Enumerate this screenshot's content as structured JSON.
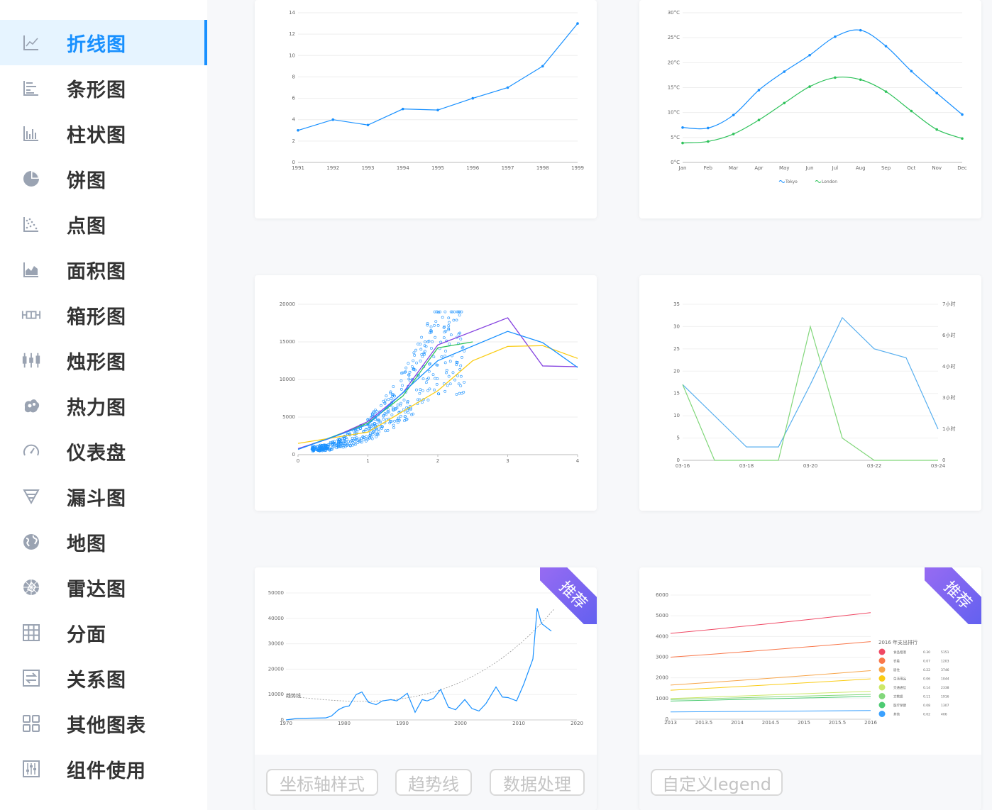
{
  "sidebar": {
    "items": [
      {
        "label": "折线图",
        "icon": "line-chart-icon"
      },
      {
        "label": "条形图",
        "icon": "bar-chart-icon"
      },
      {
        "label": "柱状图",
        "icon": "column-chart-icon"
      },
      {
        "label": "饼图",
        "icon": "pie-chart-icon"
      },
      {
        "label": "点图",
        "icon": "scatter-chart-icon"
      },
      {
        "label": "面积图",
        "icon": "area-chart-icon"
      },
      {
        "label": "箱形图",
        "icon": "box-plot-icon"
      },
      {
        "label": "烛形图",
        "icon": "candlestick-icon"
      },
      {
        "label": "热力图",
        "icon": "heatmap-icon"
      },
      {
        "label": "仪表盘",
        "icon": "gauge-icon"
      },
      {
        "label": "漏斗图",
        "icon": "funnel-icon"
      },
      {
        "label": "地图",
        "icon": "globe-icon"
      },
      {
        "label": "雷达图",
        "icon": "radar-icon"
      },
      {
        "label": "分面",
        "icon": "facet-grid-icon"
      },
      {
        "label": "关系图",
        "icon": "relation-icon"
      },
      {
        "label": "其他图表",
        "icon": "other-charts-icon"
      },
      {
        "label": "组件使用",
        "icon": "components-icon"
      }
    ],
    "active_index": 0,
    "accent_color": "#1890ff"
  },
  "cards": {
    "ribbon_label": "推荐",
    "tags_left": [
      "坐标轴样式",
      "趋势线",
      "数据处理"
    ],
    "tags_right": [
      "自定义legend"
    ]
  },
  "chart_data": [
    {
      "type": "line",
      "x": [
        "1991",
        "1992",
        "1993",
        "1994",
        "1995",
        "1996",
        "1997",
        "1998",
        "1999"
      ],
      "series": [
        {
          "values": [
            3,
            4,
            3.5,
            5,
            4.9,
            6,
            7,
            9,
            13
          ]
        }
      ],
      "yticks": [
        "0",
        "2",
        "4",
        "6",
        "8",
        "10",
        "12",
        "14"
      ],
      "ylim": [
        0,
        14
      ],
      "color": "#1890ff"
    },
    {
      "type": "line",
      "x": [
        "Jan",
        "Feb",
        "Mar",
        "Apr",
        "May",
        "Jun",
        "Jul",
        "Aug",
        "Sep",
        "Oct",
        "Nov",
        "Dec"
      ],
      "series": [
        {
          "name": "Tokyo",
          "values": [
            7,
            6.9,
            9.5,
            14.5,
            18.2,
            21.5,
            25.2,
            26.5,
            23.3,
            18.3,
            13.9,
            9.6
          ],
          "color": "#1890ff"
        },
        {
          "name": "London",
          "values": [
            3.9,
            4.2,
            5.7,
            8.5,
            11.9,
            15.2,
            17.0,
            16.6,
            14.2,
            10.3,
            6.6,
            4.8
          ],
          "color": "#2fc25b"
        }
      ],
      "yticks": [
        "0°C",
        "5°C",
        "10°C",
        "15°C",
        "20°C",
        "25°C",
        "30°C"
      ],
      "ylim": [
        0,
        30
      ]
    },
    {
      "type": "scatter",
      "xticks": [
        "0",
        "1",
        "2",
        "3",
        "4"
      ],
      "yticks": [
        "0",
        "5000",
        "10000",
        "15000",
        "20000"
      ],
      "xlim": [
        0,
        4
      ],
      "ylim": [
        0,
        20000
      ],
      "series": [
        {
          "values": [
            [
              0.2,
              1400
            ],
            [
              0.5,
              2400
            ],
            [
              1.0,
              4200
            ],
            [
              1.5,
              7800
            ],
            [
              2.0,
              14200
            ],
            [
              2.5,
              15000
            ]
          ],
          "color": "#2fc25b"
        },
        {
          "values": [
            [
              0.0,
              800
            ],
            [
              0.5,
              2300
            ],
            [
              1.0,
              4400
            ],
            [
              1.5,
              8200
            ],
            [
              2.0,
              14600
            ],
            [
              3.0,
              18200
            ],
            [
              3.5,
              11800
            ],
            [
              4.0,
              11700
            ]
          ],
          "color": "#8543e0"
        },
        {
          "values": [
            [
              0.0,
              1500
            ],
            [
              1.0,
              3000
            ],
            [
              2.0,
              8500
            ],
            [
              2.5,
              12500
            ],
            [
              3.0,
              14400
            ],
            [
              3.5,
              14500
            ],
            [
              4.0,
              12800
            ]
          ],
          "color": "#facc14"
        },
        {
          "values": [
            [
              0.0,
              700
            ],
            [
              1.0,
              4000
            ],
            [
              2.0,
              12500
            ],
            [
              3.0,
              16400
            ],
            [
              3.5,
              14900
            ],
            [
              4.0,
              11600
            ]
          ],
          "color": "#1890ff"
        }
      ]
    },
    {
      "type": "line",
      "x": [
        "03-16",
        "03-18",
        "03-20",
        "03-22",
        "03-24"
      ],
      "yticks_left": [
        "0",
        "5",
        "10",
        "15",
        "20",
        "25",
        "30",
        "35"
      ],
      "yticks_right": [
        "0",
        "1小时",
        "3小时",
        "4小时",
        "6小时",
        "7小时"
      ],
      "ylim": [
        0,
        35
      ],
      "series": [
        {
          "values": [
            17,
            3,
            3,
            17,
            32,
            25,
            23,
            7
          ],
          "color": "#58afef"
        },
        {
          "values": [
            17,
            0,
            0,
            0,
            30,
            5,
            0,
            0,
            0
          ],
          "color": "#82d77b"
        }
      ]
    },
    {
      "type": "line",
      "x": [
        "1970",
        "1980",
        "1990",
        "2000",
        "2010",
        "2020"
      ],
      "yticks": [
        "0",
        "10000",
        "20000",
        "30000",
        "40000",
        "50000"
      ],
      "ylim": [
        0,
        50000
      ],
      "annotation": "趋势线",
      "color": "#1890ff"
    },
    {
      "type": "line",
      "x": [
        "2013",
        "2013.5",
        "2014",
        "2014.5",
        "2015",
        "2015.5",
        "2016"
      ],
      "yticks": [
        "0",
        "1000",
        "2000",
        "3000",
        "4000",
        "5000",
        "6000"
      ],
      "ylim": [
        0,
        6000
      ],
      "legend_title": "2016 年支出排行",
      "legend": [
        {
          "name": "食品烟酒",
          "pct": "0.30",
          "value": "5151",
          "color": "#f04864"
        },
        {
          "name": "衣着",
          "pct": "0.07",
          "value": "1203",
          "color": "#f9774a"
        },
        {
          "name": "居住",
          "pct": "0.22",
          "value": "3746",
          "color": "#f7a54a"
        },
        {
          "name": "生活用品",
          "pct": "0.06",
          "value": "1044",
          "color": "#facc14"
        },
        {
          "name": "交通通信",
          "pct": "0.14",
          "value": "2338",
          "color": "#cde86a"
        },
        {
          "name": "文教娱",
          "pct": "0.11",
          "value": "1916",
          "color": "#82d77b"
        },
        {
          "name": "医疗保健",
          "pct": "0.08",
          "value": "1307",
          "color": "#4ecb73"
        },
        {
          "name": "其他",
          "pct": "0.02",
          "value": "406",
          "color": "#3ba1ff"
        }
      ]
    }
  ]
}
